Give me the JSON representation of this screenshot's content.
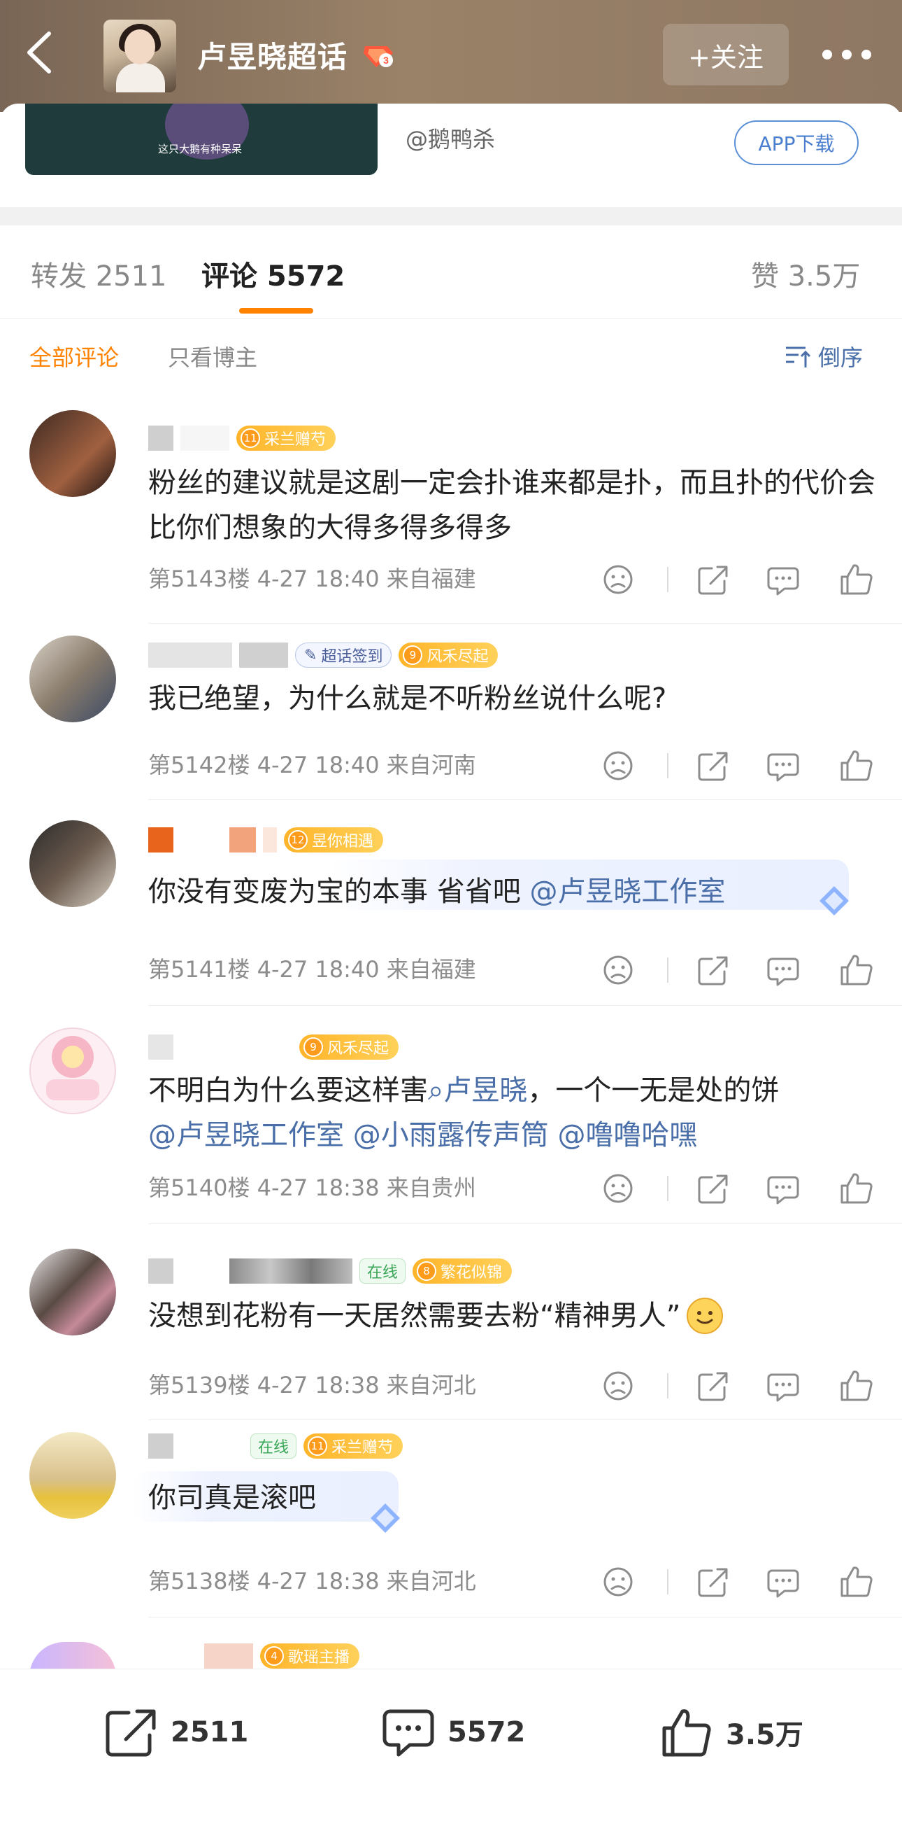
{
  "header": {
    "title": "卢昱晓超话",
    "follow_label": "+关注",
    "back_icon": "chevron-left-icon",
    "more_icon": "more-dots-icon"
  },
  "card": {
    "video_caption": "这只大鹅有种呆呆",
    "uploader": "@鹅鸭杀",
    "app_download": "APP下载"
  },
  "tabs": {
    "repost": "转发 2511",
    "comments": "评论 5572",
    "likes": "赞 3.5万"
  },
  "filters": {
    "all": "全部评论",
    "author_only": "只看博主",
    "order": "倒序"
  },
  "comments": [
    {
      "badge_level": "11",
      "badge_name": "采兰赠芍",
      "text": "粉丝的建议就是这剧一定会扑谁来都是扑，而且扑的代价会比你们想象的大得多得多得多",
      "meta": "第5143楼 4-27 18:40 来自福建"
    },
    {
      "signin_label": "超话签到",
      "badge_level": "9",
      "badge_name": "风禾尽起",
      "text": "我已绝望，为什么就是不听粉丝说什么呢?",
      "meta": "第5142楼 4-27 18:40 来自河南"
    },
    {
      "badge_level": "12",
      "badge_name": "昱你相遇",
      "text_prefix": "你没有变废为宝的本事 省省吧 ",
      "mention1": "@卢昱晓工作室",
      "meta": "第5141楼 4-27 18:40 来自福建"
    },
    {
      "badge_level": "9",
      "badge_name": "风禾尽起",
      "text_prefix": "不明白为什么要这样害",
      "topic": "卢昱晓",
      "text_mid": "，一个一无是处的饼",
      "mention1": "@卢昱晓工作室",
      "mention2": "@小雨露传声筒",
      "mention3": "@噜噜哈嘿",
      "meta": "第5140楼 4-27 18:38 来自贵州"
    },
    {
      "status": "在线",
      "badge_level": "8",
      "badge_name": "繁花似锦",
      "text": "没想到花粉有一天居然需要去粉“精神男人”",
      "meta": "第5139楼 4-27 18:38 来自河北"
    },
    {
      "status": "在线",
      "badge_level": "11",
      "badge_name": "采兰赠芍",
      "text": "你司真是滚吧",
      "meta": "第5138楼 4-27 18:38 来自河北"
    },
    {
      "badge_level": "4",
      "badge_name": "歌瑶主播"
    }
  ],
  "bottom_bar": {
    "repost_count": "2511",
    "comment_count": "5572",
    "like_count": "3.5万"
  }
}
